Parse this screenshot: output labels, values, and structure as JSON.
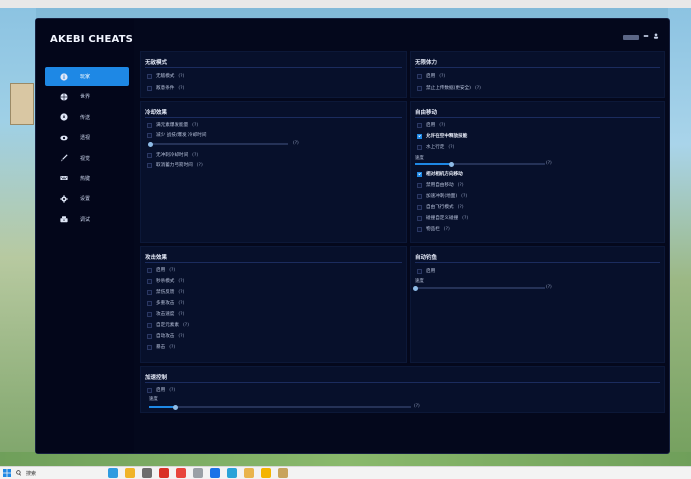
{
  "app": {
    "title": "AKEBI CHEATS"
  },
  "sidebar": {
    "items": [
      {
        "label": "玩家",
        "icon": "info-icon",
        "active": true
      },
      {
        "label": "世界",
        "icon": "globe-icon",
        "active": false
      },
      {
        "label": "传送",
        "icon": "compass-icon",
        "active": false
      },
      {
        "label": "透视",
        "icon": "eye-icon",
        "active": false
      },
      {
        "label": "视觉",
        "icon": "brush-icon",
        "active": false
      },
      {
        "label": "热键",
        "icon": "keyboard-icon",
        "active": false
      },
      {
        "label": "设置",
        "icon": "gear-icon",
        "active": false
      },
      {
        "label": "调试",
        "icon": "debug-icon",
        "active": false
      }
    ]
  },
  "panels": {
    "invincible": {
      "title": "无敌模式",
      "rows": [
        {
          "label": "无敌模式",
          "q": "(?)",
          "checked": false
        },
        {
          "label": "敌意条件",
          "q": "(?)",
          "checked": false
        }
      ]
    },
    "stamina": {
      "title": "无限体力",
      "rows": [
        {
          "label": "启用",
          "q": "(?)",
          "checked": false
        },
        {
          "label": "禁止上传数据(更安全)",
          "q": "(?)",
          "checked": false
        }
      ]
    },
    "cooldown": {
      "title": "冷却效果",
      "rows": [
        {
          "label": "满元素爆发能量",
          "q": "(?)",
          "checked": false
        },
        {
          "label": "减少 战技/爆发 冷却时间",
          "q": "",
          "checked": false
        },
        {
          "label": "无冲刺冷却时间",
          "q": "(?)",
          "checked": false
        },
        {
          "label": "取消蓄力弓箭时间",
          "q": "(?)",
          "checked": false
        }
      ],
      "slider": {
        "q": "(?)",
        "value_fraction": 0.0
      }
    },
    "movement": {
      "title": "自由移动",
      "rows": [
        {
          "label": "启用",
          "q": "(?)",
          "checked": false
        },
        {
          "label": "允许在空中释放技能",
          "q": "",
          "checked": true
        },
        {
          "label": "水上行走",
          "q": "(?)",
          "checked": false
        },
        {
          "label": "相对相机方向移动",
          "q": "",
          "checked": true
        },
        {
          "label": "禁用自由移动",
          "q": "(?)",
          "checked": false
        },
        {
          "label": "加速冲刺(地面)",
          "q": "(?)",
          "checked": false
        },
        {
          "label": "自由飞行模式",
          "q": "(?)",
          "checked": false
        },
        {
          "label": "碰撞自定义碰撞",
          "q": "(?)",
          "checked": false
        },
        {
          "label": "物品栏",
          "q": "(?)",
          "checked": false
        }
      ],
      "slider": {
        "label": "速度",
        "q": "(?)",
        "value_fraction": 0.28
      }
    },
    "attack": {
      "title": "攻击效果",
      "rows": [
        {
          "label": "启用",
          "q": "(?)",
          "checked": false
        },
        {
          "label": "秒杀模式",
          "q": "(?)",
          "checked": false
        },
        {
          "label": "禁伤反馈",
          "q": "(?)",
          "checked": false
        },
        {
          "label": "多重攻击",
          "q": "(?)",
          "checked": false
        },
        {
          "label": "攻击速度",
          "q": "(?)",
          "checked": false
        },
        {
          "label": "自定元素素",
          "q": "(?)",
          "checked": false
        },
        {
          "label": "自动攻击",
          "q": "(?)",
          "checked": false
        },
        {
          "label": "暴击",
          "q": "(?)",
          "checked": false
        }
      ]
    },
    "autofish": {
      "title": "自动钓鱼",
      "rows": [
        {
          "label": "启用",
          "q": "",
          "checked": false
        }
      ],
      "slider": {
        "label": "速度",
        "q": "(?)",
        "value_fraction": 0.0
      }
    },
    "speedctrl": {
      "title": "加速控制",
      "rows": [
        {
          "label": "启用",
          "q": "(?)",
          "checked": false
        }
      ],
      "slider": {
        "label": "速度",
        "q": "(?)",
        "value_fraction": 0.1
      }
    }
  },
  "taskbar": {
    "search_placeholder": "搜索"
  },
  "colors": {
    "accent": "#1e88e5",
    "window_bg": "#04081c",
    "panel_bg": "#07102b"
  }
}
